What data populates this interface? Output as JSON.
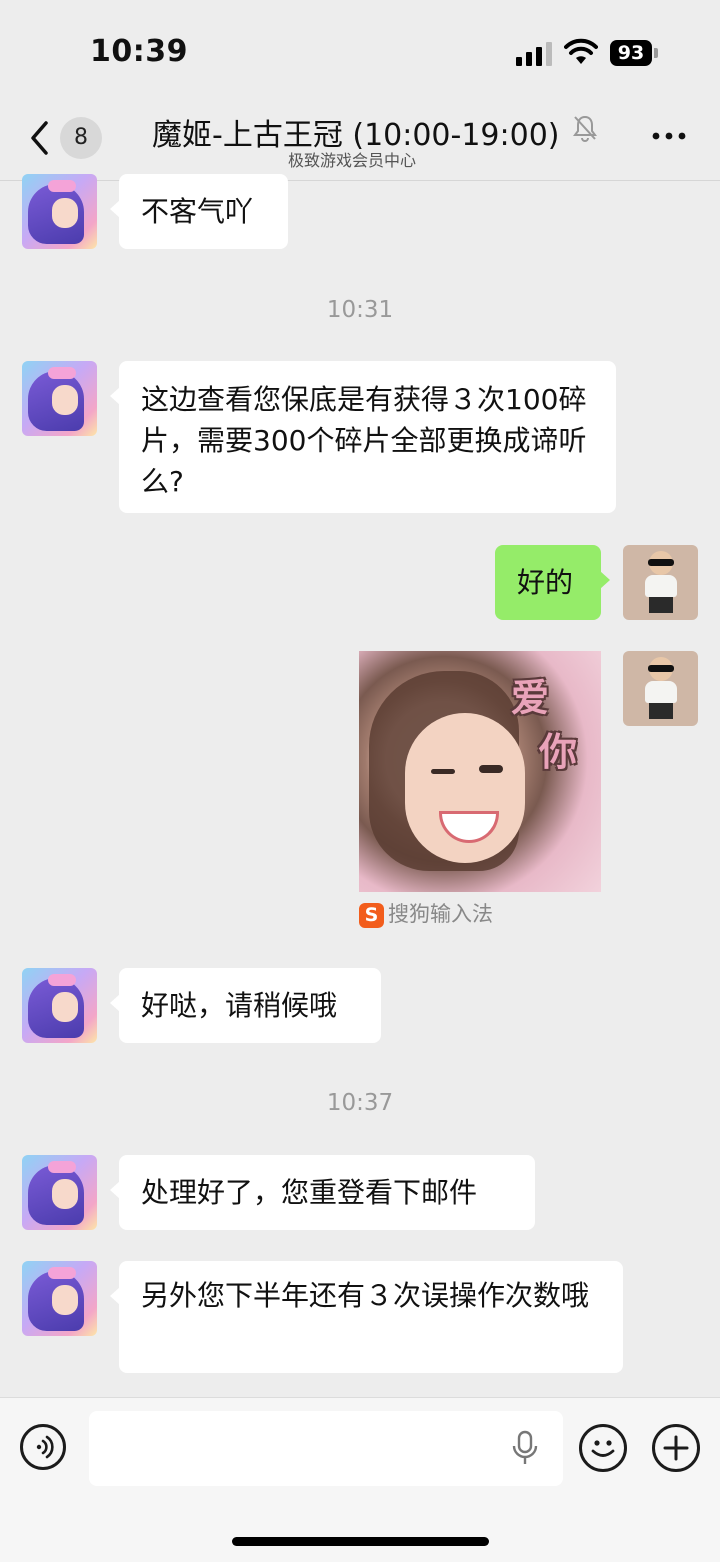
{
  "status_bar": {
    "time": "10:39",
    "battery": "93"
  },
  "nav": {
    "back_badge": "8",
    "title": "魔姬-上古王冠 (10:00-19:00)",
    "subtitle": "极致游戏会员中心"
  },
  "messages": {
    "m1": "不客气吖",
    "t1": "10:31",
    "m2": "这边查看您保底是有获得３次100碎片，需要300个碎片全部更换成谛听么?",
    "m3": "好的",
    "sticker_text_1": "爱",
    "sticker_text_2": "你",
    "sticker_source": "搜狗输入法",
    "m4": "好哒，请稍候哦",
    "t2": "10:37",
    "m5": "处理好了，您重登看下邮件",
    "m6": "另外您下半年还有３次误操作次数哦"
  },
  "input": {
    "value": ""
  },
  "icons": {
    "back": "chevron-left-icon",
    "mute": "bell-slash-icon",
    "more": "more-dots-icon",
    "voice": "voice-icon",
    "mic": "microphone-icon",
    "emoji": "emoji-icon",
    "plus": "plus-icon",
    "sogou": "sogou-logo-icon"
  },
  "colors": {
    "background": "#ededed",
    "outgoing_bubble": "#95ec69",
    "incoming_bubble": "#ffffff"
  }
}
